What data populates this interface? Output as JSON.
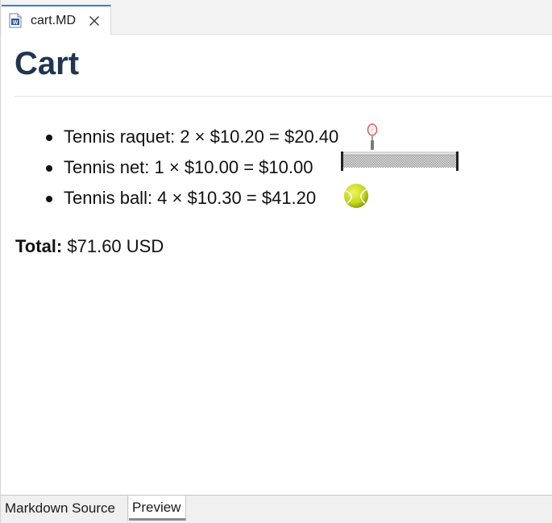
{
  "editor": {
    "tab": {
      "filename": "cart.MD",
      "icon": "word-document-icon"
    }
  },
  "document": {
    "title": "Cart",
    "items": [
      {
        "label": "Tennis raquet: 2 × $10.20 = $20.40",
        "icon": "tennis-racket-icon"
      },
      {
        "label": "Tennis net: 1 × $10.00 = $10.00",
        "icon": "tennis-net-icon"
      },
      {
        "label": "Tennis ball: 4 × $10.30 = $41.20",
        "icon": "tennis-ball-icon"
      }
    ],
    "total": {
      "label": "Total:",
      "value": "$71.60 USD"
    }
  },
  "bottom_tabs": {
    "source": "Markdown Source",
    "preview": "Preview",
    "active": "Preview"
  },
  "colors": {
    "tab_accent": "#3a7bd5",
    "title": "#1f3550",
    "ball": "#c9e02a"
  }
}
